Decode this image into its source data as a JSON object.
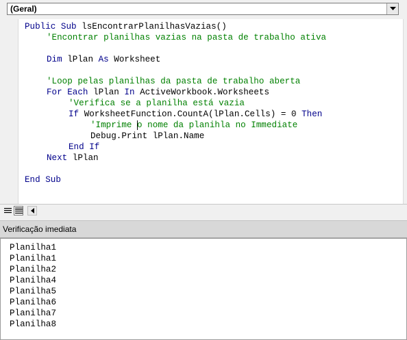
{
  "object_combo": {
    "value": "(Geral)"
  },
  "code": {
    "line1": {
      "kw": "Public Sub ",
      "text": "lsEncontrarPlanilhasVazias()"
    },
    "line2": {
      "comment": "'Encontrar planilhas vazias na pasta de trabalho ativa"
    },
    "line3": {
      "kw1": "Dim ",
      "text1": "lPlan ",
      "kw2": "As ",
      "text2": "Worksheet"
    },
    "line4": {
      "comment": "'Loop pelas planilhas da pasta de trabalho aberta"
    },
    "line5": {
      "kw1": "For Each ",
      "text1": "lPlan ",
      "kw2": "In ",
      "text2": "ActiveWorkbook.Worksheets"
    },
    "line6": {
      "comment": "'Verifica se a planilha está vazia"
    },
    "line7": {
      "kw1": "If ",
      "text1": "WorksheetFunction.CountA(lPlan.Cells) = 0 ",
      "kw2": "Then"
    },
    "line8": {
      "comment_a": "'Imprime ",
      "comment_b": "o nome da planihla no Immediate"
    },
    "line9": {
      "text": "Debug.Print lPlan.Name"
    },
    "line10": {
      "kw": "End If"
    },
    "line11": {
      "kw": "Next ",
      "text": "lPlan"
    },
    "line12": {
      "kw": "End Sub"
    }
  },
  "immediate": {
    "title": "Verificação imediata",
    "lines": [
      "Planilha1",
      "Planilha1",
      "Planilha2",
      "Planilha4",
      "Planilha5",
      "Planilha6",
      "Planilha7",
      "Planilha8"
    ]
  },
  "colors": {
    "keyword": "#00008b",
    "comment": "#008000",
    "text": "#000000"
  },
  "icons": [
    "chevron-down-icon",
    "procedure-view-icon",
    "full-module-view-icon",
    "scroll-left-icon"
  ]
}
